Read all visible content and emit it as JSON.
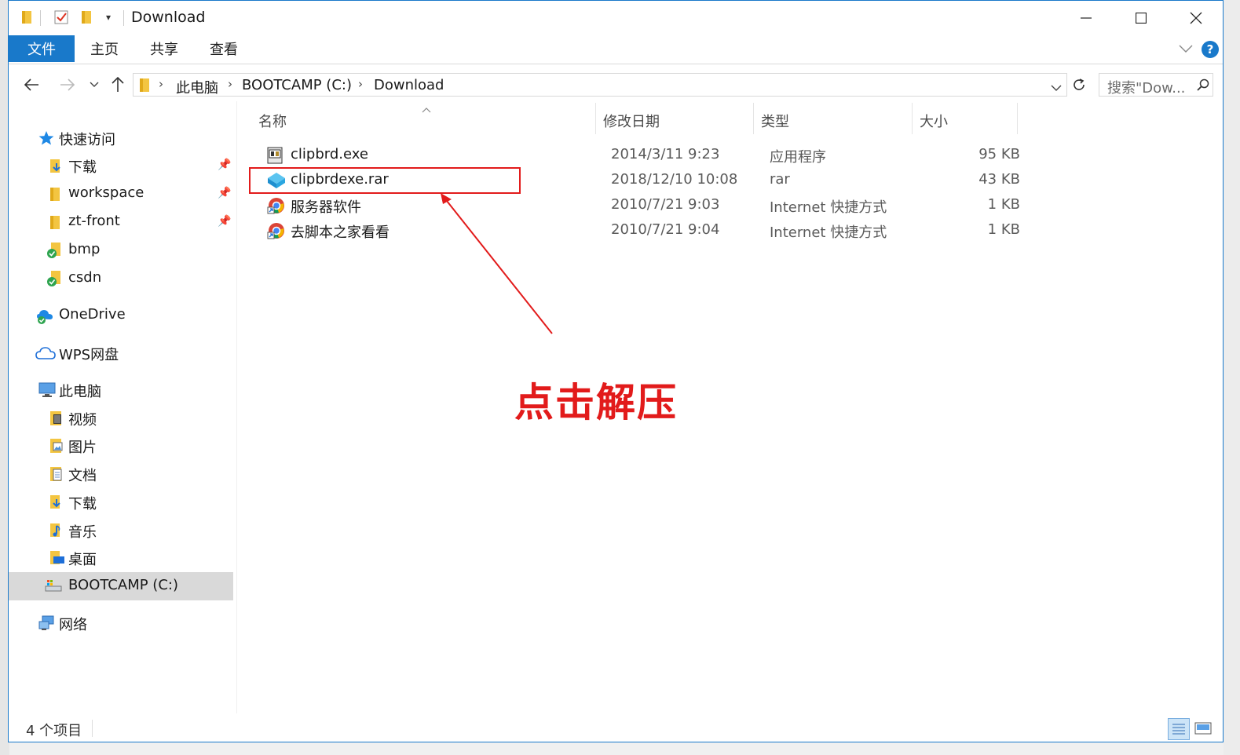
{
  "window": {
    "title": "Download"
  },
  "ribbon": {
    "file": "文件",
    "tabs": [
      "主页",
      "共享",
      "查看"
    ],
    "help": "?"
  },
  "address": {
    "crumbs": [
      "此电脑",
      "BOOTCAMP (C:)",
      "Download"
    ],
    "search_placeholder": "搜索\"Dow..."
  },
  "nav": {
    "quick_access": "快速访问",
    "quick_items": [
      {
        "label": "下载",
        "pinned": true
      },
      {
        "label": "workspace",
        "pinned": true
      },
      {
        "label": "zt-front",
        "pinned": true
      },
      {
        "label": "bmp",
        "pinned": false
      },
      {
        "label": "csdn",
        "pinned": false
      }
    ],
    "onedrive": "OneDrive",
    "wps": "WPS网盘",
    "this_pc": "此电脑",
    "pc_items": [
      "视频",
      "图片",
      "文档",
      "下载",
      "音乐",
      "桌面",
      "BOOTCAMP (C:)"
    ],
    "network": "网络"
  },
  "columns": {
    "name": "名称",
    "date": "修改日期",
    "type": "类型",
    "size": "大小"
  },
  "files": [
    {
      "name": "clipbrd.exe",
      "date": "2014/3/11 9:23",
      "type": "应用程序",
      "size": "95 KB",
      "icon": "exe-icon"
    },
    {
      "name": "clipbrdexe.rar",
      "date": "2018/12/10 10:08",
      "type": "rar",
      "size": "43 KB",
      "icon": "rar-icon"
    },
    {
      "name": "服务器软件",
      "date": "2010/7/21 9:03",
      "type": "Internet 快捷方式",
      "size": "1 KB",
      "icon": "internet-shortcut-icon"
    },
    {
      "name": "去脚本之家看看",
      "date": "2010/7/21 9:04",
      "type": "Internet 快捷方式",
      "size": "1 KB",
      "icon": "internet-shortcut-icon"
    }
  ],
  "annotation": "点击解压",
  "status": {
    "count": "4 个项目"
  },
  "colors": {
    "accent": "#1979ca",
    "annotation": "#e21b1b",
    "folder": "#f3c541",
    "selected_nav": "#d9d9d9"
  }
}
